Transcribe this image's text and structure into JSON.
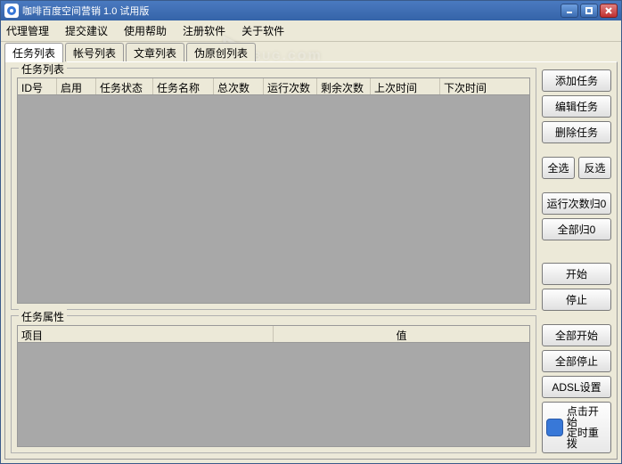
{
  "window": {
    "title": "咖啡百度空间营销 1.0 试用版"
  },
  "menu": {
    "items": [
      "代理管理",
      "提交建议",
      "使用帮助",
      "注册软件",
      "关于软件"
    ]
  },
  "tabs": {
    "items": [
      "任务列表",
      "帐号列表",
      "文章列表",
      "伪原创列表"
    ],
    "active": 0
  },
  "group_tasklist": {
    "legend": "任务列表",
    "columns": [
      "ID号",
      "启用",
      "任务状态",
      "任务名称",
      "总次数",
      "运行次数",
      "剩余次数",
      "上次时间",
      "下次时间"
    ]
  },
  "group_taskprop": {
    "legend": "任务属性",
    "columns": [
      "项目",
      "值"
    ]
  },
  "buttons": {
    "add": "添加任务",
    "edit": "编辑任务",
    "delete": "删除任务",
    "selectall": "全选",
    "invert": "反选",
    "runreset": "运行次数归0",
    "allreset": "全部归0",
    "start": "开始",
    "stop": "停止",
    "startall": "全部开始",
    "stopall": "全部停止",
    "adsl": "ADSL设置",
    "clickstart_l1": "点击开始",
    "clickstart_l2": "定时重拨"
  },
  "watermark": {
    "text": "BUG",
    "suffix": ".com"
  }
}
